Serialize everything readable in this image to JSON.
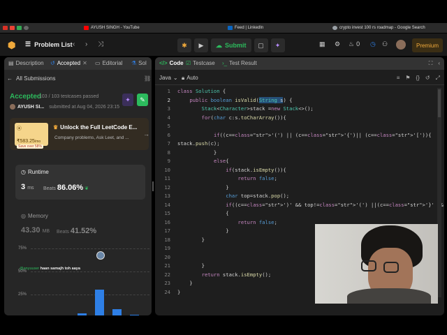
{
  "browser": {
    "bookmarks": [
      {
        "label": "AYUSH SINGH - YouTube",
        "color": "#ff0000"
      },
      {
        "label": "Feed | LinkedIn",
        "color": "#0a66c2"
      },
      {
        "label": "crypto invest 100 rs roadmap - Google Search",
        "color": "#9aa0a6"
      }
    ]
  },
  "appbar": {
    "logo": "⬢",
    "problem_list": "Problem List",
    "submit": "Submit",
    "streak": "0",
    "premium": "Premium"
  },
  "left": {
    "tabs": [
      "Description",
      "Accepted",
      "Editorial",
      "Sol"
    ],
    "all_submissions": "All Submissions",
    "status": "Accepted",
    "testcases": "103 / 103 testcases passed",
    "author": "AYUSH SI...",
    "submitted_at": "submitted at Aug 04, 2026 23:15",
    "promo": {
      "price": "₹583.25",
      "price_suffix": "/mo",
      "save": "Save over 58%",
      "title": "Unlock the Full LeetCode E...",
      "desc": "Company problems, Ask Leet, and ..."
    },
    "runtime": {
      "label": "Runtime",
      "value": "3",
      "unit": "ms",
      "beats_label": "Beats",
      "beats": "86.06%"
    },
    "memory": {
      "label": "Memory",
      "value": "43.30",
      "unit": "MB",
      "beats_label": "Beats",
      "beats": "41.52%"
    },
    "chart_note": "haan samajh toh aaya",
    "chart_user": "@anyuuser"
  },
  "chart_data": {
    "type": "bar",
    "yticks": [
      "75%",
      "50%",
      "25%"
    ],
    "values": [
      2,
      28,
      7,
      1
    ],
    "ylim": [
      0,
      75
    ]
  },
  "right": {
    "tabs": [
      "Code",
      "Testcase",
      "Test Result"
    ],
    "language": "Java",
    "autosave": "Auto",
    "code_lines": [
      "class Solution {",
      "    public boolean isValid(String s) {",
      "        Stack<Character>stack =new Stack<>();",
      "        for(char c:s.toCharArray()){",
      "",
      "            if((c=='(') || (c=='{')|| (c=='[')){",
      "stack.push(c);",
      "            }",
      "            else{",
      "                if(stack.isEmpty()){",
      "                    return false;",
      "                }",
      "                char top=stack.pop();",
      "                if((c==')' && top!='(') ||(c=='}' && top!='{')||(c==']' && top!='['))",
      "                {",
      "                    return false;",
      "                }",
      "        }",
      "",
      "",
      "        }",
      "        return stack.isEmpty();",
      "    }",
      "}"
    ]
  }
}
